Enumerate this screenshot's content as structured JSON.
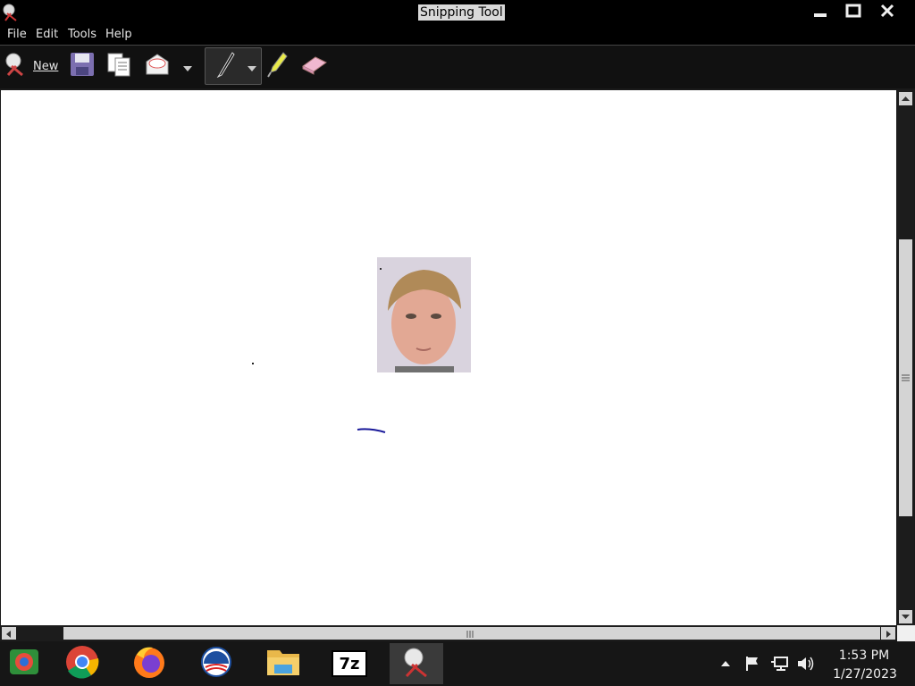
{
  "window": {
    "title": "Snipping Tool",
    "controls": [
      "minimize-icon",
      "maximize-icon",
      "close-icon"
    ]
  },
  "menu": {
    "items": [
      "File",
      "Edit",
      "Tools",
      "Help"
    ]
  },
  "toolbar": {
    "new_label": "New",
    "tools": [
      "new-snip-icon",
      "save-icon",
      "copy-icon",
      "send-snip-icon",
      "dropdown-arrow-icon",
      "pen-icon",
      "pen-dropdown-icon",
      "highlighter-icon",
      "eraser-icon"
    ]
  },
  "canvas": {
    "background": "#ffffff",
    "pen_color": "#1a1a9a"
  },
  "taskbar": {
    "apps": [
      "chrome-remote-icon",
      "chrome-icon",
      "firefox-icon",
      "obama-logo-icon",
      "file-explorer-icon",
      "7zip-icon",
      "snipping-tool-icon"
    ],
    "seven_zip_label": "7z",
    "clock": {
      "time": "1:53 PM",
      "date": "1/27/2023"
    },
    "tray": [
      "show-hidden-icons",
      "action-center-flag-icon",
      "network-icon",
      "volume-icon"
    ]
  }
}
